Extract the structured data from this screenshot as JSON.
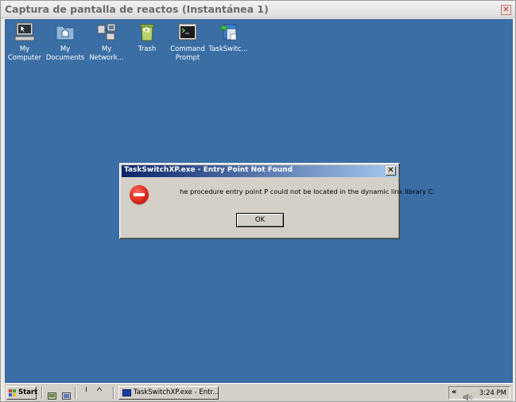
{
  "host": {
    "title": "Captura de pantalla de reactos (Instantánea 1)",
    "close_glyph": "✕"
  },
  "desktop": {
    "background": "#3a6ea5",
    "icons": [
      {
        "label": "My\nComputer",
        "icon": "my-computer-icon"
      },
      {
        "label": "My\nDocuments",
        "icon": "my-documents-icon"
      },
      {
        "label": "My\nNetwork...",
        "icon": "my-network-icon"
      },
      {
        "label": "Trash",
        "icon": "trash-icon"
      },
      {
        "label": "Command\nPrompt",
        "icon": "command-prompt-icon"
      },
      {
        "label": "TaskSwitc...",
        "icon": "taskswitch-icon"
      }
    ]
  },
  "dialog": {
    "title": "TaskSwitchXP.exe - Entry Point Not Found",
    "close_glyph": "✕",
    "message": "he procedure entry point P could not be located in the dynamic link library C.",
    "ok_label": "OK",
    "icon": "error-icon"
  },
  "taskbar": {
    "start_label": "Start",
    "task_label": "TaskSwitchXP.exe - Entr...",
    "tray_chevron": "«",
    "clock": "3:24 PM"
  }
}
